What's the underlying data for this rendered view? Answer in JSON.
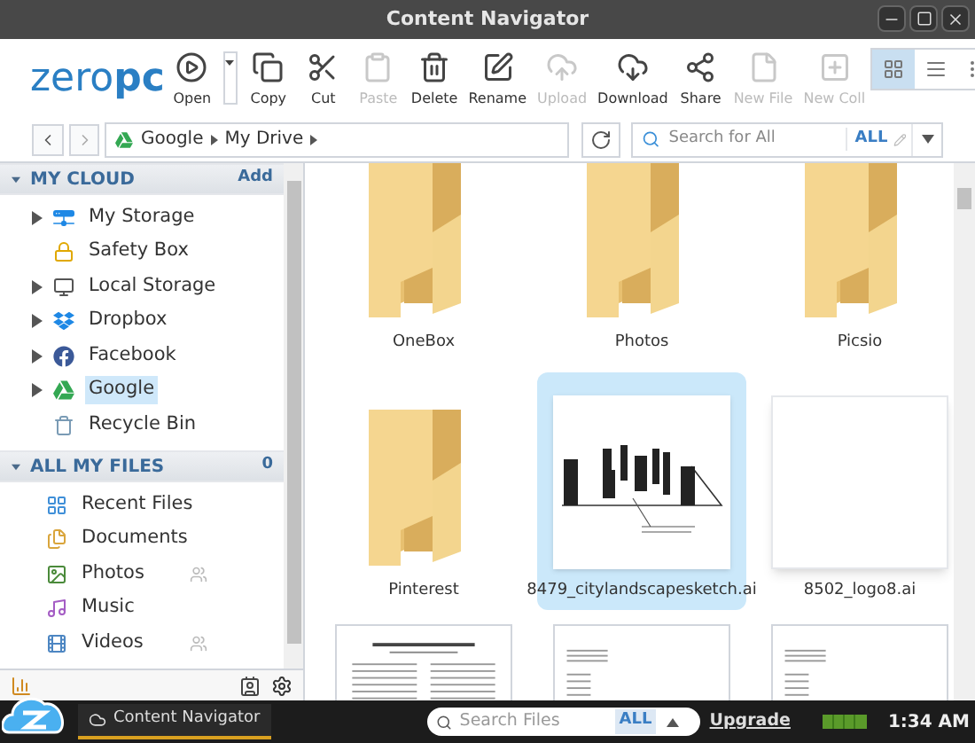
{
  "window": {
    "title": "Content Navigator"
  },
  "logo": {
    "light": "zero",
    "bold": "pc"
  },
  "toolbar": [
    {
      "kind": "open",
      "label": "Open",
      "disabled": false
    },
    {
      "kind": "copy",
      "label": "Copy",
      "disabled": false
    },
    {
      "kind": "cut",
      "label": "Cut",
      "disabled": false
    },
    {
      "kind": "paste",
      "label": "Paste",
      "disabled": true
    },
    {
      "kind": "delete",
      "label": "Delete",
      "disabled": false
    },
    {
      "kind": "rename",
      "label": "Rename",
      "disabled": false
    },
    {
      "kind": "upload",
      "label": "Upload",
      "disabled": true
    },
    {
      "kind": "download",
      "label": "Download",
      "disabled": false
    },
    {
      "kind": "share",
      "label": "Share",
      "disabled": false
    },
    {
      "kind": "newfile",
      "label": "New File",
      "disabled": true
    },
    {
      "kind": "newcoll",
      "label": "New Coll",
      "disabled": true
    }
  ],
  "views": [
    {
      "kind": "grid",
      "selected": true
    },
    {
      "kind": "list",
      "selected": false
    },
    {
      "kind": "tiles",
      "selected": false
    }
  ],
  "breadcrumb": [
    "Google",
    "My Drive"
  ],
  "search": {
    "placeholder": "Search for All",
    "scope": "ALL"
  },
  "sidebar": {
    "sections": [
      {
        "title": "MY CLOUD",
        "action": "Add",
        "expanded": true,
        "items": [
          {
            "kind": "storage",
            "label": "My Storage",
            "expandable": true,
            "selected": false,
            "shared": false
          },
          {
            "kind": "vault",
            "label": "Safety Box",
            "expandable": false,
            "selected": false,
            "shared": false
          },
          {
            "kind": "local",
            "label": "Local Storage",
            "expandable": true,
            "selected": false,
            "shared": false
          },
          {
            "kind": "dropbox",
            "label": "Dropbox",
            "expandable": true,
            "selected": false,
            "shared": false
          },
          {
            "kind": "facebook",
            "label": "Facebook",
            "expandable": true,
            "selected": false,
            "shared": false
          },
          {
            "kind": "google",
            "label": "Google",
            "expandable": true,
            "selected": true,
            "shared": false
          },
          {
            "kind": "trash",
            "label": "Recycle Bin",
            "expandable": false,
            "selected": false,
            "shared": false
          }
        ]
      },
      {
        "title": "ALL MY FILES",
        "action": "0",
        "expanded": true,
        "items": [
          {
            "kind": "recent",
            "label": "Recent Files",
            "expandable": false,
            "selected": false,
            "shared": false
          },
          {
            "kind": "documents",
            "label": "Documents",
            "expandable": false,
            "selected": false,
            "shared": false
          },
          {
            "kind": "photos",
            "label": "Photos",
            "expandable": false,
            "selected": false,
            "shared": true
          },
          {
            "kind": "music",
            "label": "Music",
            "expandable": false,
            "selected": false,
            "shared": false
          },
          {
            "kind": "videos",
            "label": "Videos",
            "expandable": false,
            "selected": false,
            "shared": true
          }
        ]
      }
    ]
  },
  "files": [
    {
      "kind": "folder",
      "name": "OneBox",
      "selected": false
    },
    {
      "kind": "folder",
      "name": "Photos",
      "selected": false
    },
    {
      "kind": "folder",
      "name": "Picsio",
      "selected": false
    },
    {
      "kind": "folder",
      "name": "Pinterest",
      "selected": false
    },
    {
      "kind": "sketch",
      "name": "8479_citylandscapesketch.ai",
      "selected": true
    },
    {
      "kind": "blank",
      "name": "8502_logo8.ai",
      "selected": false
    },
    {
      "kind": "paper",
      "selected": false
    },
    {
      "kind": "table",
      "selected": false
    },
    {
      "kind": "table",
      "selected": false
    }
  ],
  "taskbar": {
    "task": "Content Navigator",
    "search_placeholder": "Search Files",
    "scope": "ALL",
    "upgrade": "Upgrade",
    "time": "1:34 AM"
  }
}
